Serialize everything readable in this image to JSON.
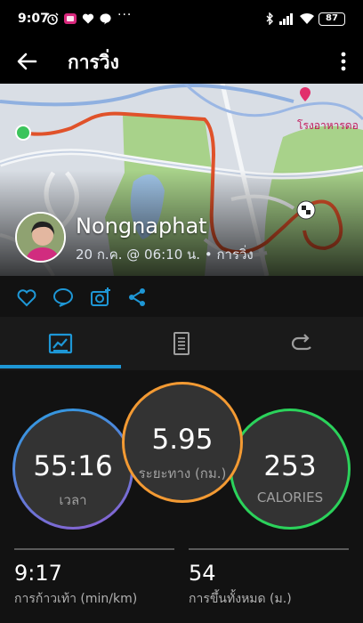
{
  "status_bar": {
    "time": "9:07",
    "dots": "···",
    "battery": "87",
    "icons": [
      "alarm-icon",
      "app-badge-icon",
      "heart-icon",
      "chat-bubble-icon",
      "bluetooth-icon",
      "signal-icon",
      "wifi-icon",
      "battery-icon"
    ]
  },
  "header": {
    "title": "การวิ่ง",
    "back_icon": "arrow-left-icon",
    "menu_icon": "more-vert-icon"
  },
  "map": {
    "poi_label": "โรงอาหารดอ",
    "route_color": "#e0522a",
    "park_color": "#a8d28a"
  },
  "activity": {
    "user_name": "Nongnaphat",
    "subtitle": "20 ก.ค. @ 06:10 น. • การวิ่ง"
  },
  "actions": [
    "like-icon",
    "comment-icon",
    "add-photo-icon",
    "share-icon"
  ],
  "tabs": [
    {
      "icon": "stats-icon",
      "active": true
    },
    {
      "icon": "details-icon",
      "active": false
    },
    {
      "icon": "laps-icon",
      "active": false
    }
  ],
  "accent": "#1e97d6",
  "summary": {
    "time": {
      "value": "55:16",
      "label": "เวลา"
    },
    "distance": {
      "value": "5.95",
      "label": "ระยะทาง (กม.)"
    },
    "calories": {
      "value": "253",
      "label": "CALORIES"
    }
  },
  "stats": [
    {
      "value": "9:17",
      "label": "การก้าวเท้า (min/km)"
    },
    {
      "value": "54",
      "label": "การขึ้นทั้งหมด (ม.)"
    }
  ]
}
